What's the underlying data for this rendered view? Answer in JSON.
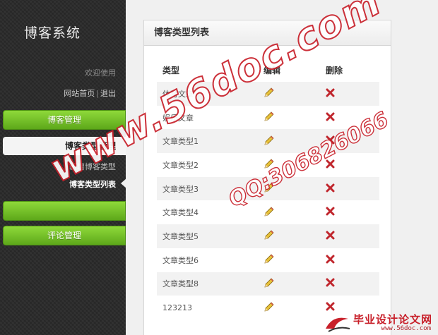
{
  "sidebar": {
    "title": "博客系统",
    "welcome": "欢迎使用",
    "links": {
      "home": "网站首页",
      "separator": "|",
      "logout": "退出"
    },
    "nav": [
      {
        "label": "博客管理"
      },
      {
        "label": "博客类型管理"
      },
      {
        "label": ""
      },
      {
        "label": "评论管理"
      }
    ],
    "subitems": [
      {
        "label": "新增博客类型"
      },
      {
        "label": "博客类型列表"
      }
    ]
  },
  "panel": {
    "title": "博客类型列表",
    "columns": [
      "类型",
      "编辑",
      "删除"
    ],
    "rows": [
      {
        "name": "体育文章"
      },
      {
        "name": "娱乐文章"
      },
      {
        "name": "文章类型1"
      },
      {
        "name": "文章类型2"
      },
      {
        "name": "文章类型3"
      },
      {
        "name": "文章类型4"
      },
      {
        "name": "文章类型5"
      },
      {
        "name": "文章类型6"
      },
      {
        "name": "文章类型8"
      },
      {
        "name": "123213"
      }
    ]
  },
  "watermark": {
    "main": "www.56doc.com",
    "qq": "QQ:306826066",
    "site_cn": "毕业设计论文网",
    "site_url": "www.56doc.com"
  },
  "colors": {
    "sidebar_bg": "#2a2a2a",
    "nav_green": "#6fbf22",
    "delete_red": "#c0262d",
    "edit_pencil": "#e0b52a"
  },
  "icons": {
    "edit": "pencil-icon",
    "delete": "delete-x-icon"
  }
}
